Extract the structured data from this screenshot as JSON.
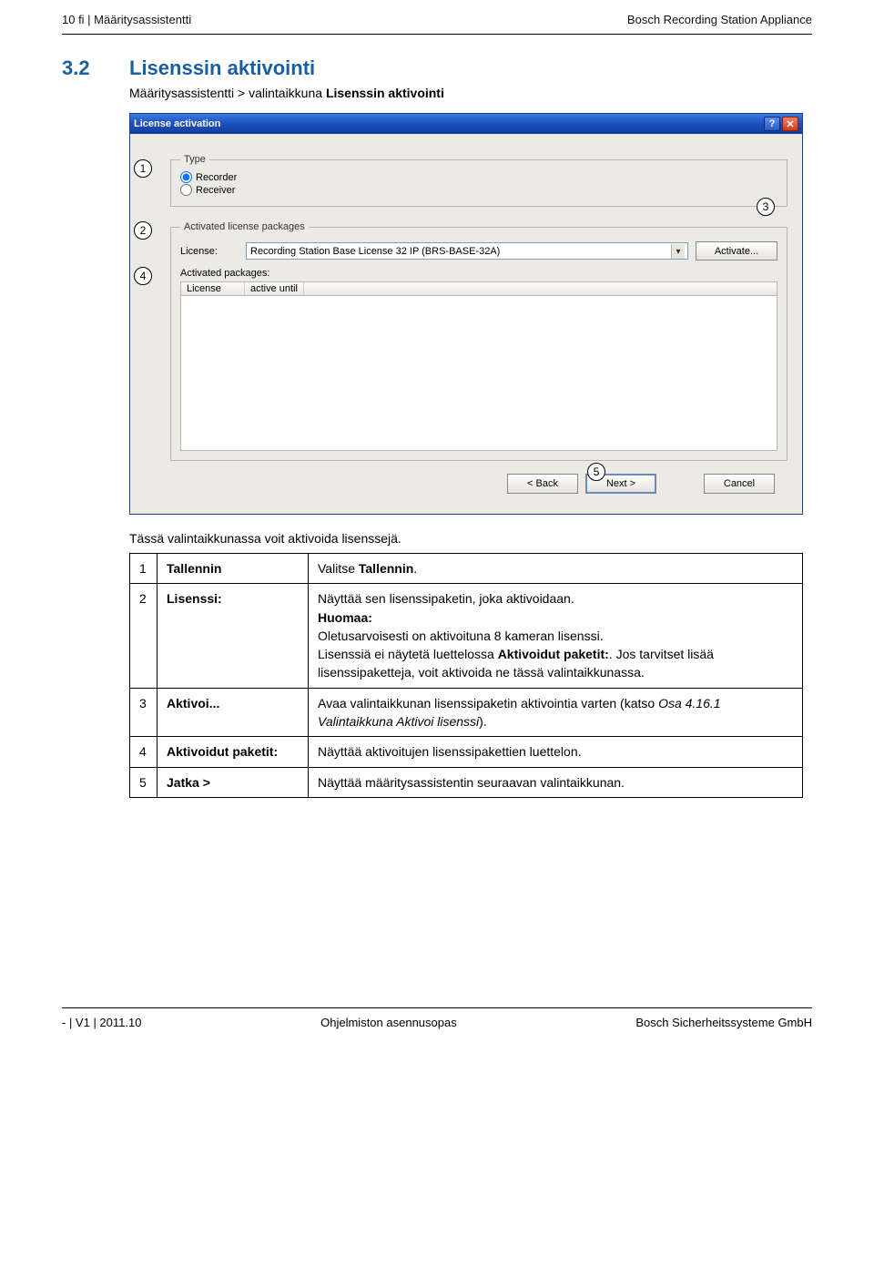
{
  "header": {
    "left": "10    fi | Määritysassistentti",
    "right": "Bosch Recording Station Appliance"
  },
  "section": {
    "num": "3.2",
    "title": "Lisenssin aktivointi"
  },
  "breadcrumb": {
    "pre": "Määritysassistentti > valintaikkuna ",
    "bold": "Lisenssin aktivointi"
  },
  "win": {
    "title": "License activation",
    "help": "?",
    "close": "✕",
    "type_legend": "Type",
    "radio_recorder": "Recorder",
    "radio_receiver": "Receiver",
    "alp_legend": "Activated license packages",
    "license_label": "License:",
    "license_value": "Recording Station Base License 32 IP (BRS-BASE-32A)",
    "activate_btn": "Activate...",
    "act_pkts_label": "Activated packages:",
    "col_license": "License",
    "col_until": "active until",
    "back": "< Back",
    "next": "Next >",
    "cancel": "Cancel"
  },
  "callouts": {
    "c1": "1",
    "c2": "2",
    "c3": "3",
    "c4": "4",
    "c5": "5"
  },
  "caption": "Tässä valintaikkunassa voit aktivoida lisenssejä.",
  "table": {
    "r1n": "1",
    "r1k": "Tallennin",
    "r1v_a": "Valitse ",
    "r1v_b": "Tallennin",
    "r1v_c": ".",
    "r2n": "2",
    "r2k": "Lisenssi:",
    "r2v_l1": "Näyttää sen lisenssipaketin, joka aktivoidaan.",
    "r2v_l2": "Huomaa:",
    "r2v_l3": "Oletusarvoisesti on aktivoituna 8 kameran lisenssi.",
    "r2v_l4a": "Lisenssiä ei näytetä luettelossa ",
    "r2v_l4b": "Aktivoidut paketit:",
    "r2v_l4c": ". Jos tarvitset lisää lisenssipaketteja, voit aktivoida ne tässä valintaikkunassa.",
    "r3n": "3",
    "r3k": "Aktivoi...",
    "r3v_a": "Avaa valintaikkunan lisenssipaketin aktivointia varten (katso ",
    "r3v_b": "Osa 4.16.1 Valintaikkuna Aktivoi lisenssi",
    "r3v_c": ").",
    "r4n": "4",
    "r4k": "Aktivoidut paketit:",
    "r4v": "Näyttää aktivoitujen lisenssipakettien luettelon.",
    "r5n": "5",
    "r5k": "Jatka >",
    "r5v": "Näyttää määritysassistentin seuraavan valintaikkunan."
  },
  "footer": {
    "left": "- | V1 | 2011.10",
    "center": "Ohjelmiston asennusopas",
    "right": "Bosch Sicherheitssysteme GmbH"
  }
}
